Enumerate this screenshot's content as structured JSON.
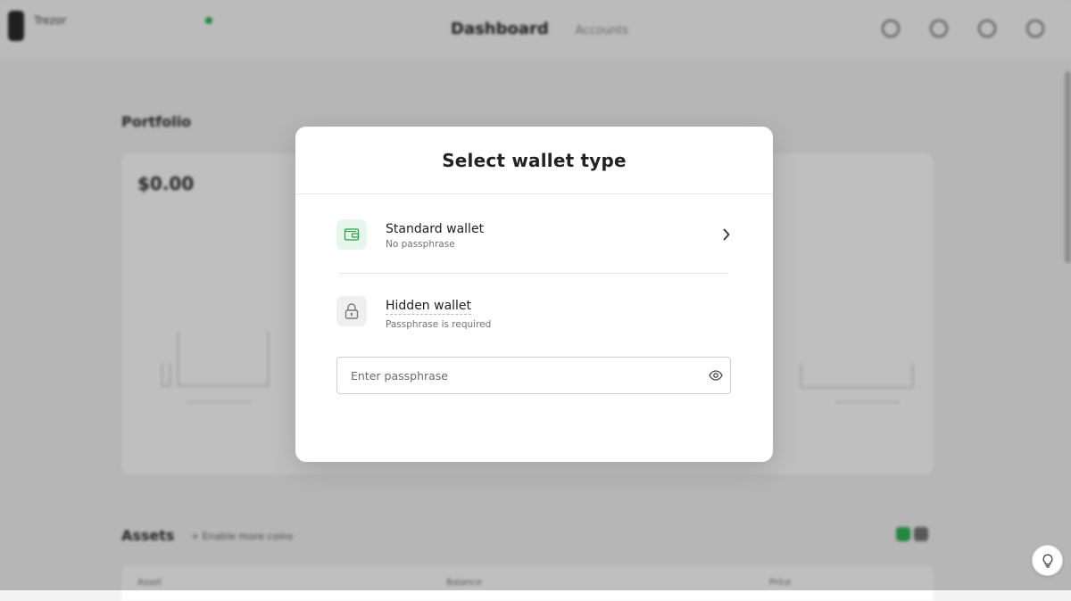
{
  "app": {
    "device_name": "Trezor",
    "nav": {
      "dashboard": "Dashboard",
      "accounts": "Accounts"
    },
    "portfolio": {
      "title": "Portfolio",
      "value": "$0.00"
    },
    "assets": {
      "title": "Assets",
      "subtitle": "+ Enable more coins",
      "columns": [
        "Asset",
        "Balance",
        "Price"
      ]
    },
    "colors": {
      "accent": "#30b356"
    }
  },
  "modal": {
    "title": "Select wallet type",
    "standard": {
      "label": "Standard wallet",
      "description": "No passphrase",
      "icon": "wallet-icon"
    },
    "hidden": {
      "label": "Hidden wallet",
      "description": "Passphrase is required",
      "icon": "lock-icon"
    },
    "passphrase": {
      "placeholder": "Enter passphrase",
      "value": ""
    }
  },
  "hint": {
    "icon": "lightbulb-icon"
  }
}
